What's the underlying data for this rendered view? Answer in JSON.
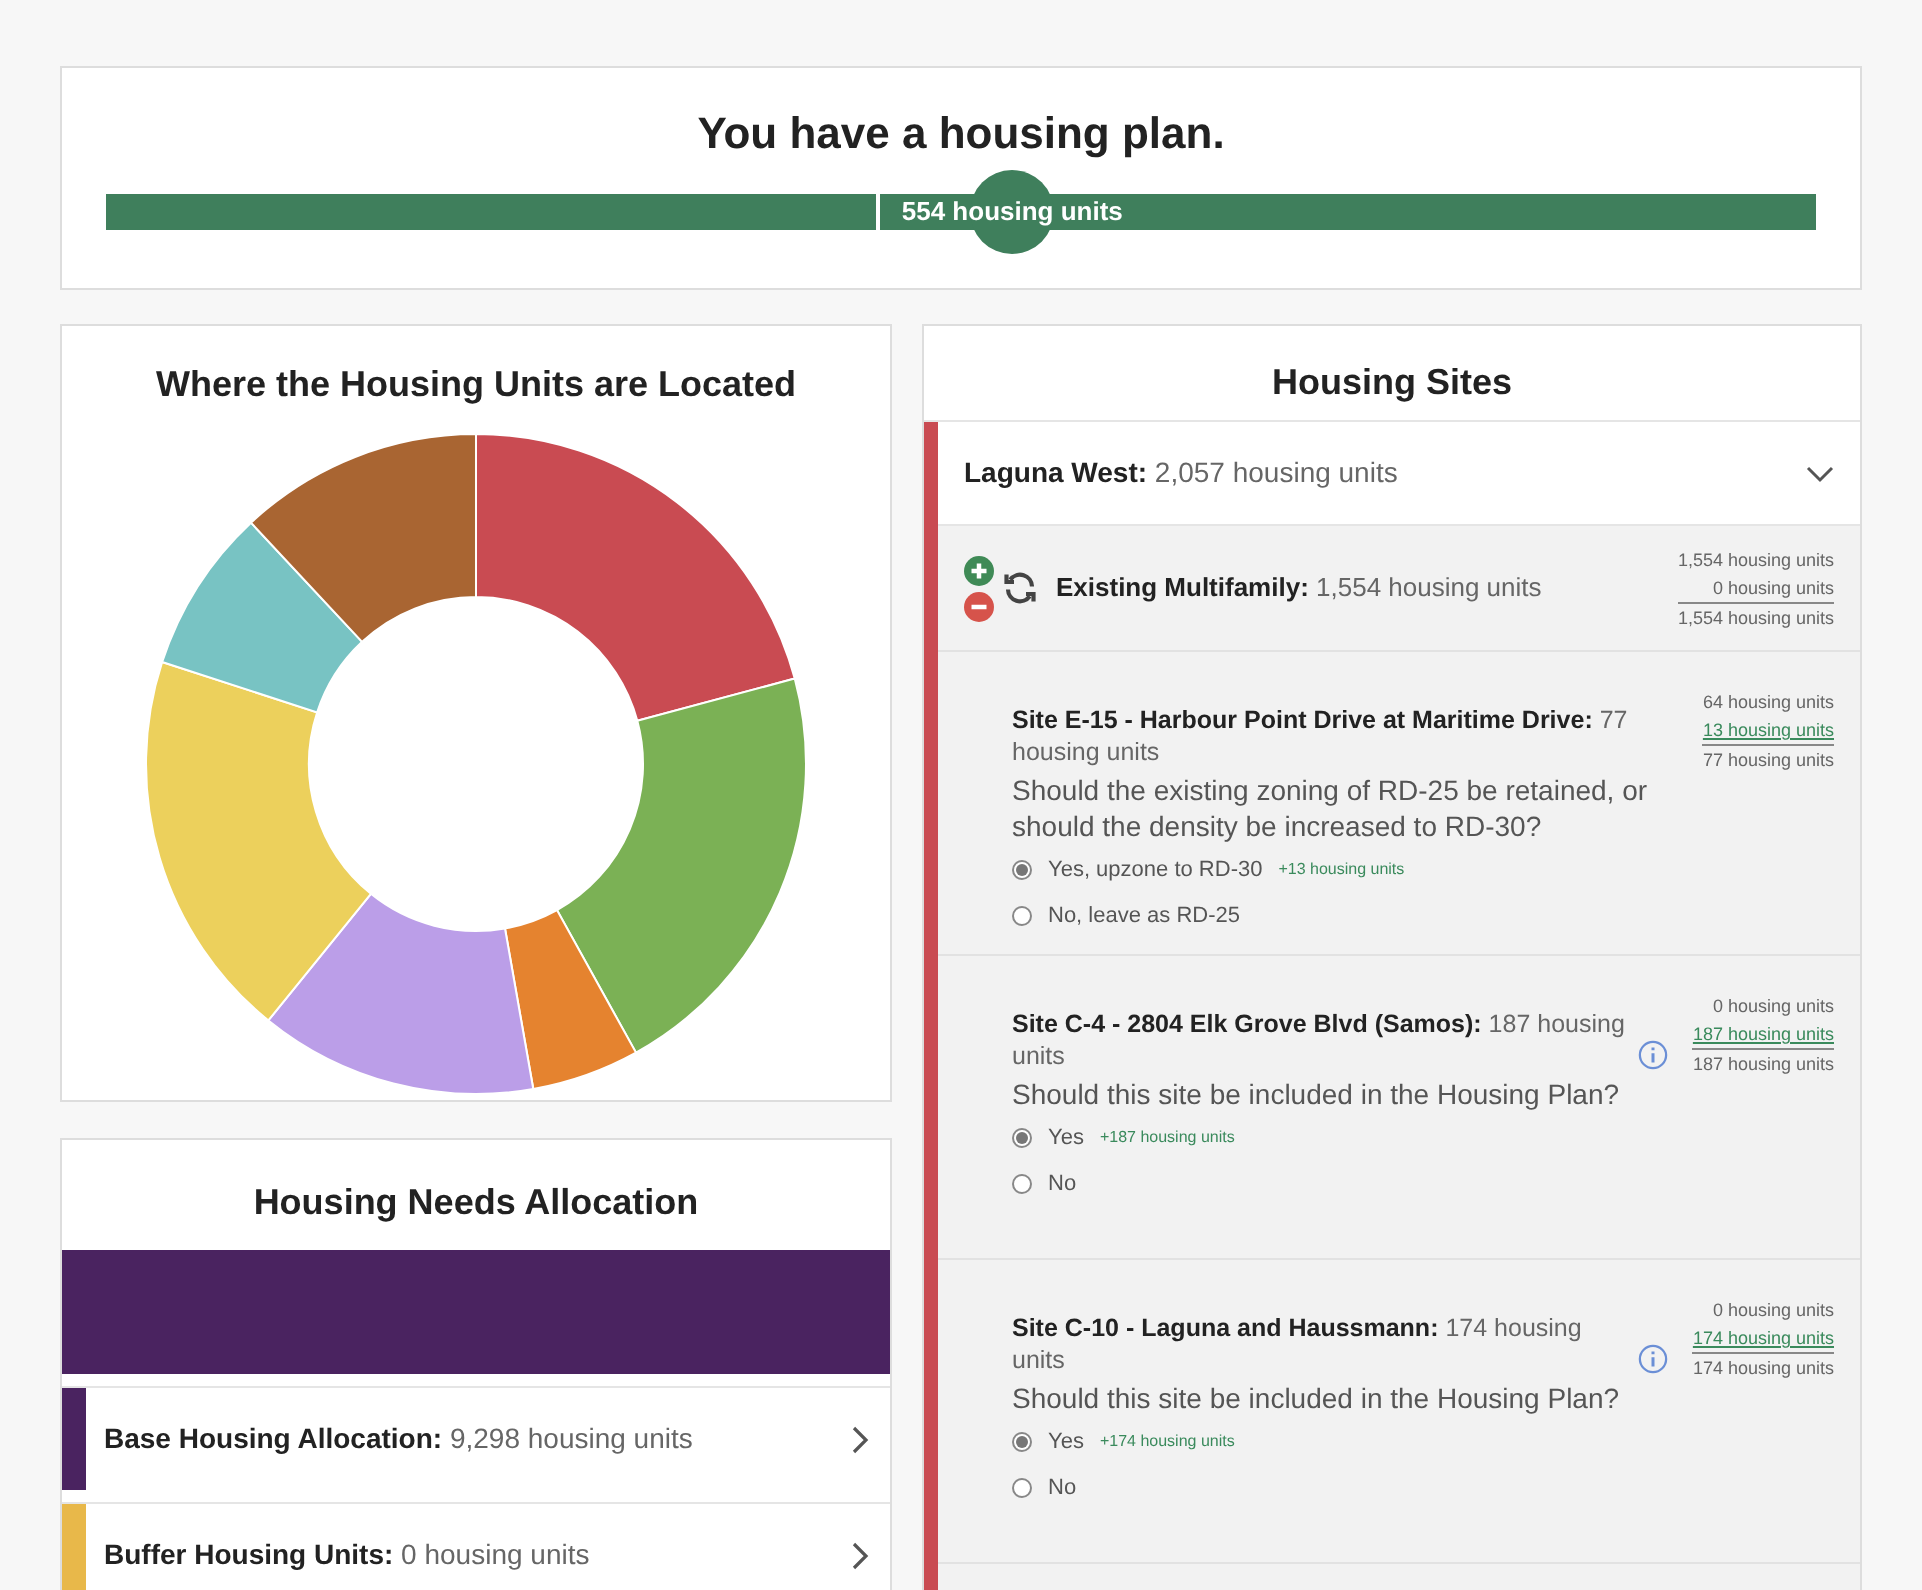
{
  "plan": {
    "title": "You have a housing plan.",
    "level": 1,
    "reading": "554 housing units"
  },
  "location_card": {
    "title": "Where the Housing Units are Located"
  },
  "needs_card": {
    "title": "Housing Needs Allocation",
    "level": 1,
    "rows": [
      {
        "text": "**Base Housing Allocation:** 9,298 housing units",
        "color": "#4a2360"
      },
      {
        "text": "**Buffer Housing Units:** 0 housing units",
        "color": "#e8b84a"
      }
    ]
  },
  "sites_card": {
    "title": "Housing Sites",
    "group": {
      "text": "**Laguna West:** 2,057 housing units",
      "color": "#c94b52",
      "expanded": true,
      "existing": {
        "text": "**Existing Multifamily:** 1,554 housing units",
        "tally": [
          {
            "text": "1,554 housing units",
            "highlight": false
          },
          {
            "text": "0 housing units",
            "highlight": false
          },
          {
            "text": "1,554 housing units",
            "highlight": false
          }
        ]
      },
      "sites": [
        {
          "title": "**Site E-15 - Harbour Point Drive at Maritime Drive:** 77 housing units",
          "info": false,
          "question": "Should the existing zoning of RD-25 be retained, or should the density be increased to RD-30?",
          "tally": [
            {
              "text": "64 housing units",
              "highlight": false
            },
            {
              "text": "13 housing units",
              "highlight": true
            },
            {
              "text": "77 housing units",
              "highlight": false
            }
          ],
          "options": [
            {
              "label": "Yes, upzone to RD-30",
              "delta": "+13 housing units",
              "selected": true
            },
            {
              "label": "No, leave as RD-25",
              "selected": false
            }
          ]
        },
        {
          "title": "**Site C-4 - 2804 Elk Grove Blvd (Samos):** 187 housing units",
          "info": true,
          "question": "Should this site be included in the Housing Plan?",
          "tally": [
            {
              "text": "0 housing units",
              "highlight": false
            },
            {
              "text": "187 housing units",
              "highlight": true
            },
            {
              "text": "187 housing units",
              "highlight": false
            }
          ],
          "options": [
            {
              "label": "Yes",
              "delta": "+187 housing units",
              "selected": true
            },
            {
              "label": "No",
              "selected": false
            }
          ]
        },
        {
          "title": "**Site C-10 - Laguna and Haussmann:** 174 housing units",
          "info": true,
          "question": "Should this site be included in the Housing Plan?",
          "tally": [
            {
              "text": "0 housing units",
              "highlight": false
            },
            {
              "text": "174 housing units",
              "highlight": true
            },
            {
              "text": "174 housing units",
              "highlight": false
            }
          ],
          "options": [
            {
              "label": "Yes",
              "delta": "+174 housing units",
              "selected": true
            },
            {
              "label": "No",
              "selected": false
            }
          ]
        }
      ]
    }
  }
}
